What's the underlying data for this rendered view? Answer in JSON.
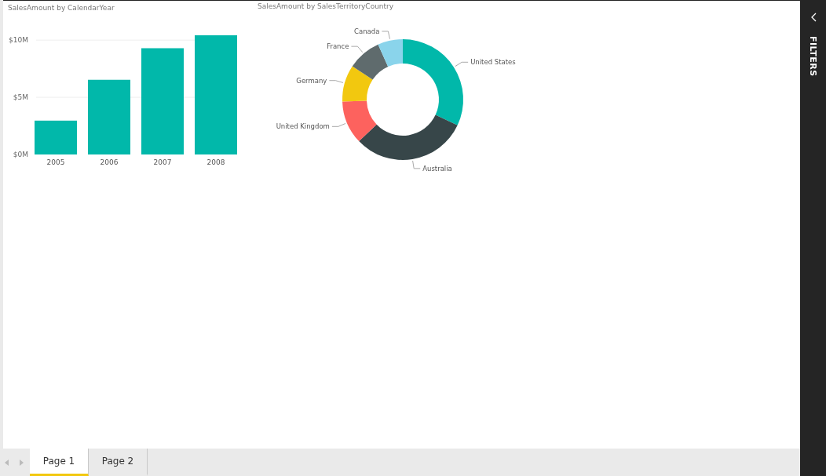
{
  "visuals": [
    {
      "title": "SalesAmount by CalendarYear",
      "chart_data": {
        "type": "bar",
        "categories": [
          "2005",
          "2006",
          "2007",
          "2008"
        ],
        "series": [
          {
            "color": "#01b8aa",
            "values": [
              2.96,
              6.53,
              9.29,
              10.42
            ]
          }
        ],
        "ylim": [
          0,
          10.42
        ],
        "yticks": [
          {
            "value": 0,
            "label": "$0M"
          },
          {
            "value": 5,
            "label": "$5M"
          },
          {
            "value": 10,
            "label": "$10M"
          }
        ]
      }
    },
    {
      "title": "SalesAmount by SalesTerritoryCountry",
      "chart_data": {
        "type": "donut",
        "categories": [
          "United States",
          "Australia",
          "United Kingdom",
          "Germany",
          "France",
          "Canada"
        ],
        "series": [
          {
            "values": [
              32.0,
              30.9,
              11.6,
              9.8,
              9.0,
              6.7
            ]
          }
        ],
        "colors": [
          "#01b8aa",
          "#374649",
          "#fd625e",
          "#f2c80f",
          "#5f6b6d",
          "#8ad4eb"
        ]
      }
    }
  ],
  "pages": [
    {
      "label": "Page 1",
      "selected": true
    },
    {
      "label": "Page 2",
      "selected": false
    }
  ],
  "filters_pane": {
    "label": "FILTERS"
  }
}
